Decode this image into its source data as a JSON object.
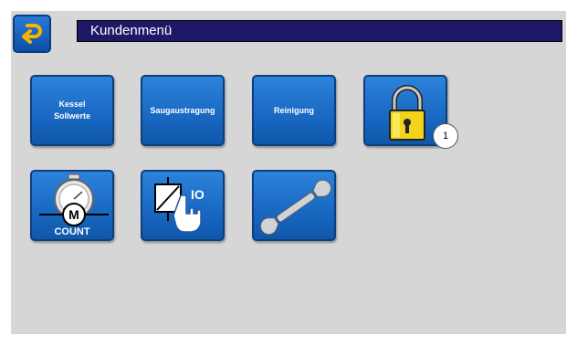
{
  "header": {
    "title": "Kundenmenü"
  },
  "icons": {
    "back": "back-arrow-icon",
    "lock": "padlock-icon",
    "count": "stopwatch-motor-icon",
    "io": "relay-hand-icon",
    "service": "wrench-icon"
  },
  "tiles": {
    "kessel_sollwerte": "Kessel\nSollwerte",
    "saugaustragung": "Saugaustragung",
    "reinigung": "Reinigung",
    "count_label": "COUNT",
    "motor_letter": "M",
    "io_label": "IO"
  },
  "badge": {
    "number": "1"
  },
  "colors": {
    "tile": "#1a6ac4",
    "titlebar": "#1e1866",
    "background": "#d6d6d6",
    "lock": "#f2d41a"
  }
}
